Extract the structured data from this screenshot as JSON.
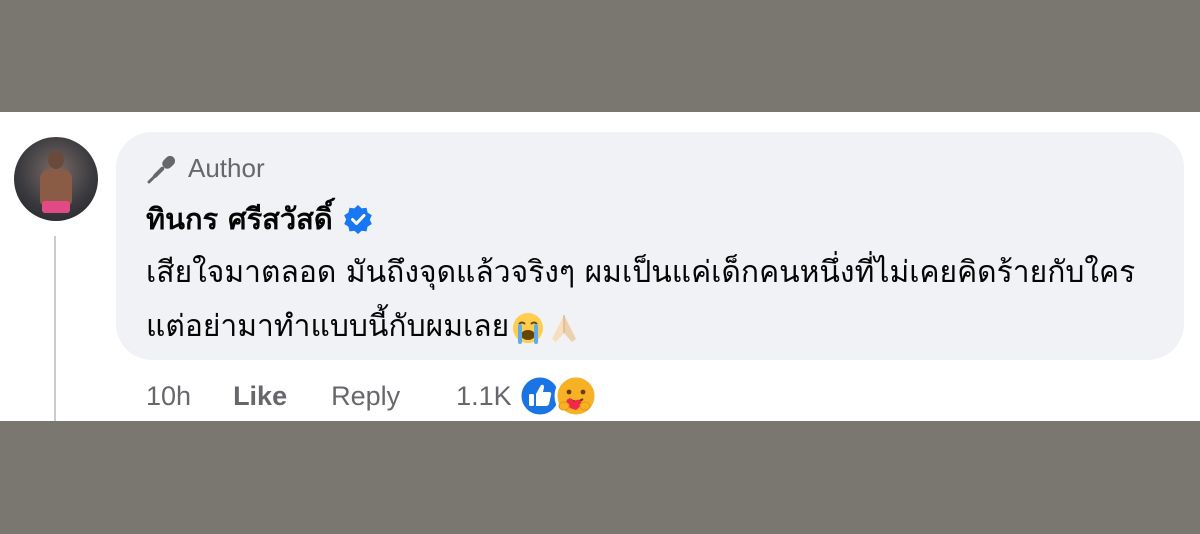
{
  "comment": {
    "author_badge": "Author",
    "author_name": "ทินกร ศรีสวัสดิ์",
    "verified": true,
    "text": "เสียใจมาตลอด มันถึงจุดแล้วจริงๆ ผมเป็นแค่เด็กคนหนึ่งที่ไม่เคยคิดร้ายกับใคร แต่อย่ามาทำแบบนี้กับผมเลย",
    "trailing_emojis": [
      "crying-face",
      "folded-hands"
    ]
  },
  "actions": {
    "timestamp": "10h",
    "like_label": "Like",
    "reply_label": "Reply",
    "reaction_count": "1.1K",
    "reactions": [
      "like",
      "care"
    ]
  },
  "colors": {
    "background_band": "#7a7770",
    "bubble": "#f0f2f5",
    "secondary_text": "#65676b",
    "verified_blue": "#1877f2",
    "like_blue": "#1b74e4"
  }
}
